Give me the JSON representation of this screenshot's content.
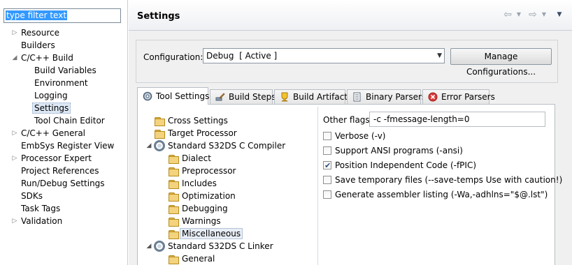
{
  "filter": {
    "value": "type filter text"
  },
  "nav": {
    "items": [
      {
        "label": "Resource",
        "twisty": "closed"
      },
      {
        "label": "Builders",
        "twisty": ""
      },
      {
        "label": "C/C++ Build",
        "twisty": "open"
      },
      {
        "label": "Build Variables",
        "twisty": ""
      },
      {
        "label": "Environment",
        "twisty": ""
      },
      {
        "label": "Logging",
        "twisty": ""
      },
      {
        "label": "Settings",
        "twisty": ""
      },
      {
        "label": "Tool Chain Editor",
        "twisty": ""
      },
      {
        "label": "C/C++ General",
        "twisty": "closed"
      },
      {
        "label": "EmbSys Register View",
        "twisty": ""
      },
      {
        "label": "Processor Expert",
        "twisty": "closed"
      },
      {
        "label": "Project References",
        "twisty": ""
      },
      {
        "label": "Run/Debug Settings",
        "twisty": ""
      },
      {
        "label": "SDKs",
        "twisty": ""
      },
      {
        "label": "Task Tags",
        "twisty": ""
      },
      {
        "label": "Validation",
        "twisty": "closed"
      }
    ]
  },
  "header": {
    "title": "Settings"
  },
  "config": {
    "label": "Configuration:",
    "selected": "Debug  [ Active ]",
    "manage_label": "Manage Configurations..."
  },
  "tabs": [
    {
      "label": "Tool Settings",
      "icon": "tool-settings-icon"
    },
    {
      "label": "Build Steps",
      "icon": "build-steps-icon"
    },
    {
      "label": "Build Artifact",
      "icon": "build-artifact-icon"
    },
    {
      "label": "Binary Parsers",
      "icon": "binary-parsers-icon"
    },
    {
      "label": "Error Parsers",
      "icon": "error-parsers-icon"
    }
  ],
  "tree": {
    "items": [
      {
        "label": "Cross Settings",
        "icon": "folder"
      },
      {
        "label": "Target Processor",
        "icon": "folder"
      },
      {
        "label": "Standard S32DS C Compiler",
        "icon": "gear"
      },
      {
        "label": "Dialect",
        "icon": "folder"
      },
      {
        "label": "Preprocessor",
        "icon": "folder"
      },
      {
        "label": "Includes",
        "icon": "folder"
      },
      {
        "label": "Optimization",
        "icon": "folder"
      },
      {
        "label": "Debugging",
        "icon": "folder"
      },
      {
        "label": "Warnings",
        "icon": "folder"
      },
      {
        "label": "Miscellaneous",
        "icon": "folder"
      },
      {
        "label": "Standard S32DS C Linker",
        "icon": "gear"
      },
      {
        "label": "General",
        "icon": "folder"
      }
    ]
  },
  "options": {
    "other_flags_label": "Other flags",
    "other_flags_value": "-c -fmessage-length=0",
    "checkboxes": [
      {
        "label": "Verbose (-v)",
        "checked": false
      },
      {
        "label": "Support ANSI programs (-ansi)",
        "checked": false
      },
      {
        "label": "Position Independent Code (-fPIC)",
        "checked": true
      },
      {
        "label": "Save temporary files (--save-temps Use with caution!)",
        "checked": false
      },
      {
        "label": "Generate assembler listing (-Wa,-adhlns=\"$@.lst\")",
        "checked": false
      }
    ]
  }
}
